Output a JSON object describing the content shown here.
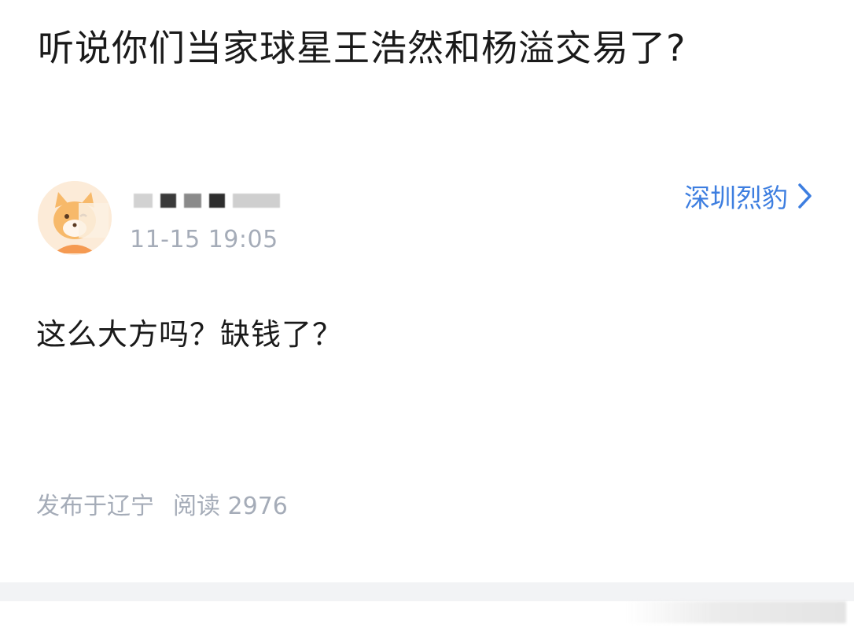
{
  "post": {
    "title": "听说你们当家球星王浩然和杨溢交易了?"
  },
  "author": {
    "timestamp": "11-15 19:05"
  },
  "team": {
    "name": "深圳烈豹",
    "icon": "chevron-right-icon",
    "color": "#3d7ee0"
  },
  "comment": {
    "text": "这么大方吗？缺钱了？"
  },
  "meta": {
    "location": "发布于辽宁",
    "reads": "阅读 2976"
  }
}
